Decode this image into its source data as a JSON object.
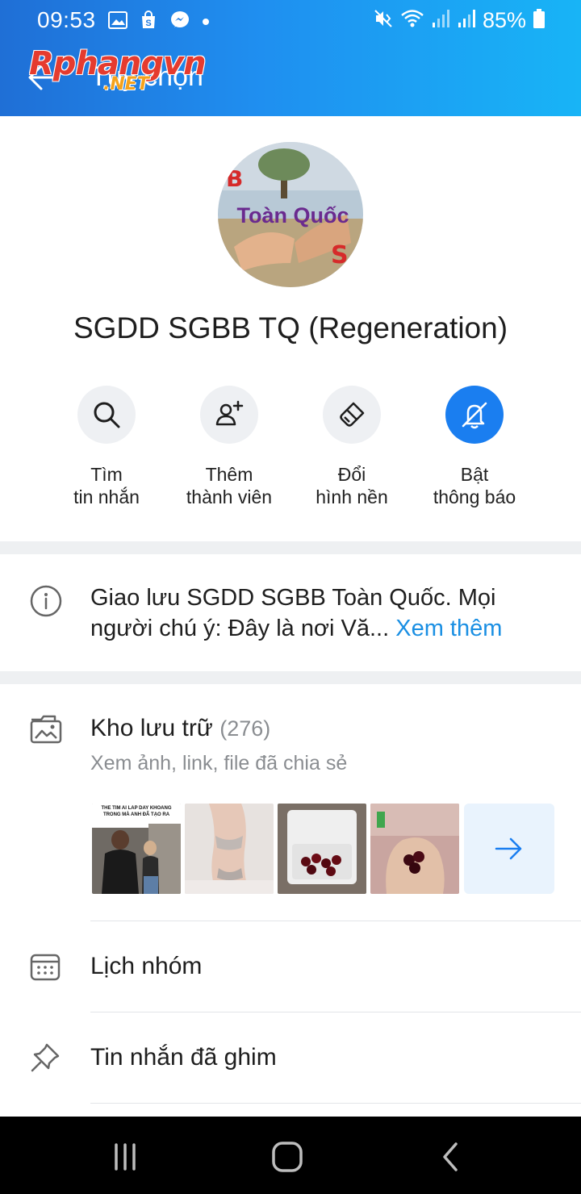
{
  "status_bar": {
    "time": "09:53",
    "battery": "85%"
  },
  "app_bar": {
    "title": "Tùy chọn",
    "watermark": "Rphangvn",
    "watermark_sub": ".NET"
  },
  "group": {
    "avatar_text": "Toàn Quốc",
    "name": "SGDD SGBB TQ (Regeneration)"
  },
  "actions": [
    {
      "line1": "Tìm",
      "line2": "tin nhắn",
      "icon": "search-icon"
    },
    {
      "line1": "Thêm",
      "line2": "thành viên",
      "icon": "add-member-icon"
    },
    {
      "line1": "Đổi",
      "line2": "hình nền",
      "icon": "paint-brush-icon"
    },
    {
      "line1": "Bật",
      "line2": "thông báo",
      "icon": "bell-off-icon"
    }
  ],
  "info": {
    "text": "Giao lưu SGDD SGBB Toàn Quốc. Mọi người chú ý: Đây là nơi Vă...",
    "see_more": "Xem thêm"
  },
  "storage": {
    "title": "Kho lưu trữ",
    "count": "(276)",
    "subtitle": "Xem ảnh, link, file đã chia sẻ",
    "thumb_caption": "THE TIM AI LAP DAY KHOANG TRONG MÀ ANH ĐÃ TẠO RA"
  },
  "menu": {
    "calendar": "Lịch nhóm",
    "pinned": "Tin nhắn đã ghim"
  },
  "colors": {
    "accent": "#1a7ef0",
    "link": "#1a8fe3",
    "header_start": "#1f6fd6",
    "header_end": "#18b4f6"
  }
}
